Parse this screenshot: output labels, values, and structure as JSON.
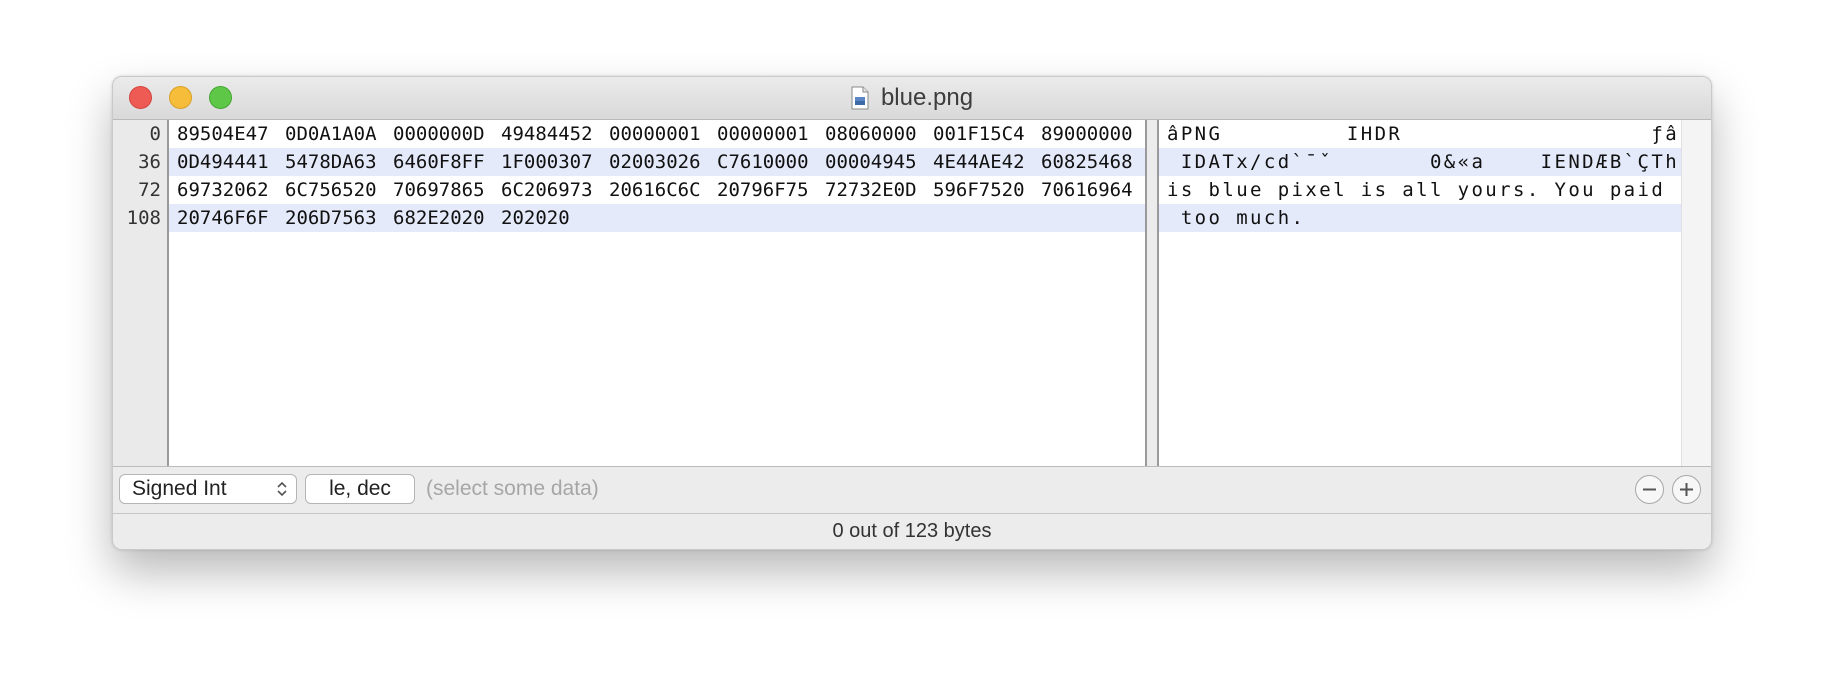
{
  "window": {
    "title": "blue.png",
    "file_icon": "png-file-icon"
  },
  "hex_view": {
    "line_numbers": [
      "0",
      "36",
      "72",
      "108"
    ],
    "rows": [
      [
        "89504E47",
        "0D0A1A0A",
        "0000000D",
        "49484452",
        "00000001",
        "00000001",
        "08060000",
        "001F15C4",
        "89000000"
      ],
      [
        "0D494441",
        "5478DA63",
        "6460F8FF",
        "1F000307",
        "02003026",
        "C7610000",
        "00004945",
        "4E44AE42",
        "60825468"
      ],
      [
        "69732062",
        "6C756520",
        "70697865",
        "6C206973",
        "20616C6C",
        "20796F75",
        "72732E0D",
        "596F7520",
        "70616964"
      ],
      [
        "20746F6F",
        "206D7563",
        "682E2020",
        "202020"
      ]
    ],
    "text_rows": [
      "âPNG         IHDR                  ƒâ",
      " IDATx/cd`ˉˇ       0&«a    IENDÆB`ÇTh",
      "is blue pixel is all yours. You paid",
      " too much."
    ]
  },
  "inspector": {
    "type_select": "Signed Int",
    "format_button": "le, dec",
    "hint": "(select some data)",
    "remove_icon": "minus-icon",
    "add_icon": "plus-icon"
  },
  "status": {
    "text": "0 out of 123 bytes"
  }
}
